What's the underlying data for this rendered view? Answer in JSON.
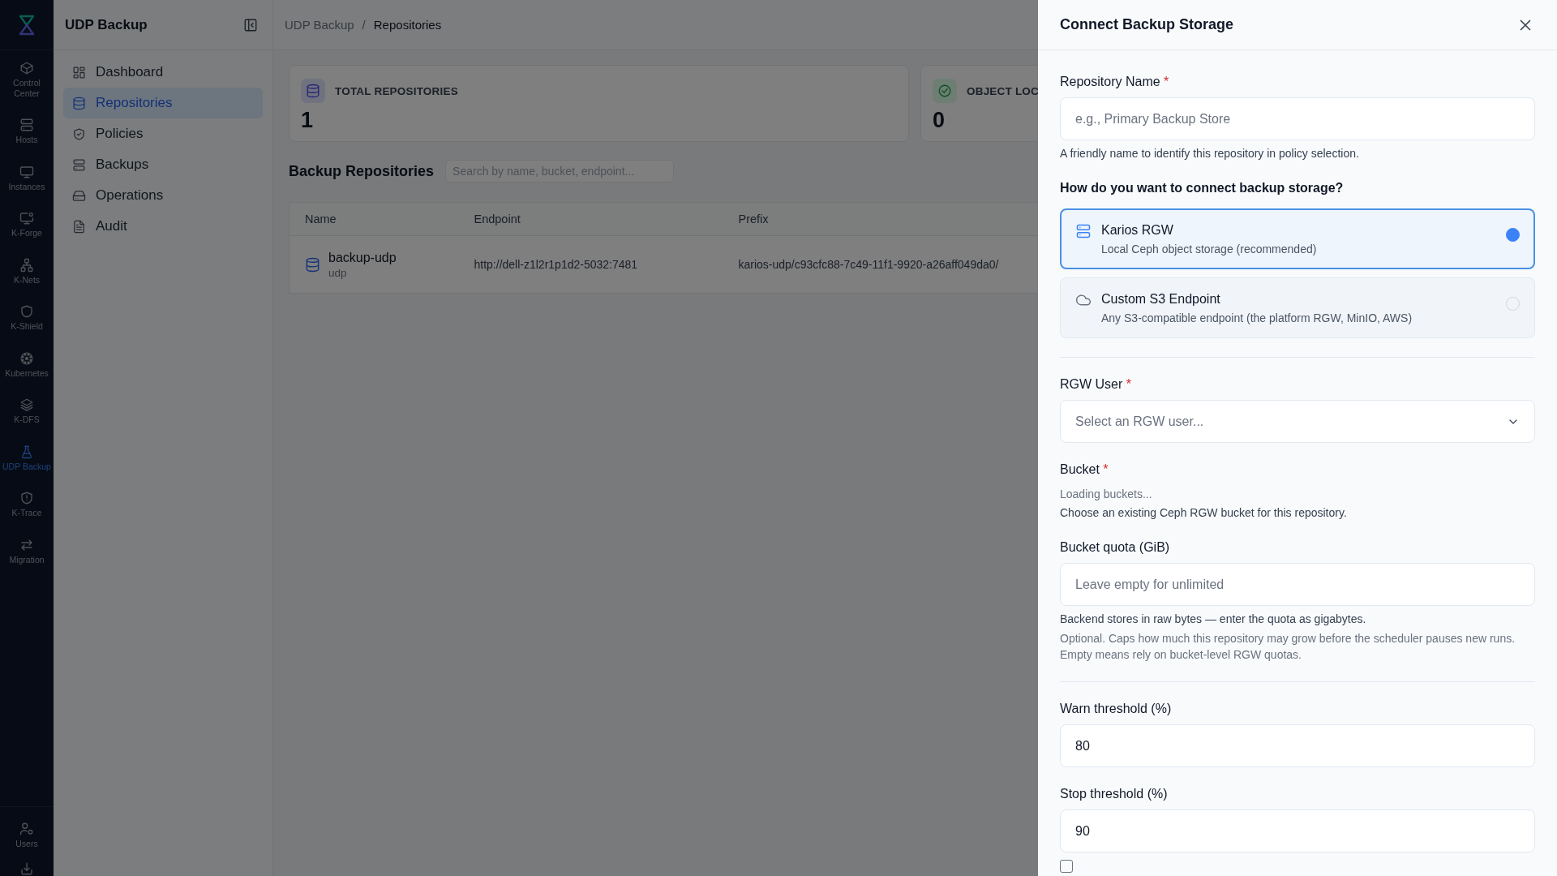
{
  "rail": {
    "items": [
      {
        "label": "Control Center",
        "selected": false
      },
      {
        "label": "Hosts",
        "selected": false
      },
      {
        "label": "Instances",
        "selected": false
      },
      {
        "label": "K-Forge",
        "selected": false
      },
      {
        "label": "K-Nets",
        "selected": false
      },
      {
        "label": "K-Shield",
        "selected": false
      },
      {
        "label": "Kubernetes",
        "selected": false
      },
      {
        "label": "K-DFS",
        "selected": false
      },
      {
        "label": "UDP Backup",
        "selected": true
      },
      {
        "label": "K-Trace",
        "selected": false
      },
      {
        "label": "Migration",
        "selected": false
      }
    ],
    "bottom_items": [
      {
        "label": "Users",
        "selected": false
      }
    ]
  },
  "sidebar": {
    "title": "UDP Backup",
    "items": [
      {
        "label": "Dashboard",
        "selected": false
      },
      {
        "label": "Repositories",
        "selected": true
      },
      {
        "label": "Policies",
        "selected": false
      },
      {
        "label": "Backups",
        "selected": false
      },
      {
        "label": "Operations",
        "selected": false
      },
      {
        "label": "Audit",
        "selected": false
      }
    ]
  },
  "breadcrumb": {
    "items": [
      "UDP Backup",
      "Repositories"
    ],
    "separator": "/"
  },
  "stats": [
    {
      "label": "TOTAL REPOSITORIES",
      "value": "1",
      "kind": "database"
    },
    {
      "label": "OBJECT LOC",
      "value": "0",
      "kind": "check"
    }
  ],
  "repositories": {
    "title": "Backup Repositories",
    "search": {
      "placeholder": "Search by name, bucket, endpoint..."
    },
    "table": {
      "columns": [
        "Name",
        "Endpoint",
        "Prefix"
      ],
      "rows": [
        {
          "name": "backup-udp",
          "subtitle": "udp",
          "endpoint": "http://dell-z1l2r1p1d2-5032:7481",
          "prefix": "karios-udp/c93cfc88-7c49-11f1-9920-a26aff049da0/"
        }
      ]
    }
  },
  "drawer": {
    "title": "Connect Backup Storage",
    "fields": [
      {
        "kind": "input",
        "label": "Repository Name",
        "marker": "*",
        "placeholder": "e.g., Primary Backup Store",
        "help": [
          {
            "text": "A friendly name to identify this repository in policy selection.",
            "muted": false
          }
        ]
      },
      {
        "kind": "choice",
        "label": "How do you want to connect backup storage?",
        "options": [
          {
            "kind": "server",
            "title": "Karios RGW",
            "description": "Local Ceph object storage (recommended)",
            "selected": true
          },
          {
            "kind": "cloud",
            "title": "Custom S3 Endpoint",
            "description": "Any S3-compatible endpoint (the platform RGW, MinIO, AWS)",
            "selected": false
          }
        ]
      },
      {
        "kind": "divider"
      },
      {
        "kind": "select",
        "label": "RGW User",
        "marker": "*",
        "placeholder": "Select an RGW user..."
      },
      {
        "kind": "status",
        "label": "Bucket",
        "marker": "*",
        "status": "Loading buckets...",
        "help": [
          {
            "text": "Choose an existing Ceph RGW bucket for this repository.",
            "muted": false
          }
        ]
      },
      {
        "kind": "input",
        "label": "Bucket quota (GiB)",
        "placeholder": "Leave empty for unlimited",
        "help": [
          {
            "text": "Backend stores in raw bytes — enter the quota as gigabytes.",
            "muted": false
          },
          {
            "text": "Optional. Caps how much this repository may grow before the scheduler pauses new runs. Empty means rely on bucket-level RGW quotas.",
            "muted": true
          }
        ]
      },
      {
        "kind": "divider"
      },
      {
        "kind": "input",
        "label": "Warn threshold (%)",
        "value": "80"
      },
      {
        "kind": "input",
        "label": "Stop threshold (%)",
        "value": "90"
      },
      {
        "kind": "checkbox",
        "checked": false
      }
    ]
  }
}
